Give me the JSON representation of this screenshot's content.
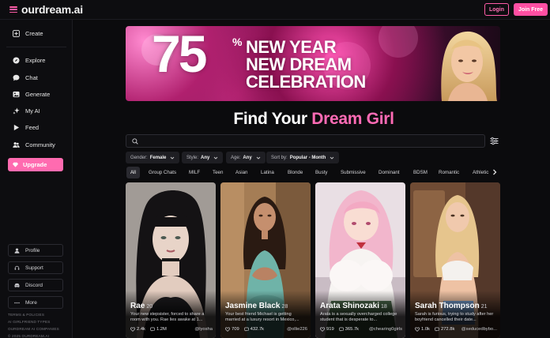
{
  "header": {
    "logo": "ourdream.ai",
    "login_label": "Login",
    "join_label": "Join Free"
  },
  "sidebar": {
    "items": [
      {
        "label": "Create",
        "icon": "plus-square-icon"
      },
      {
        "label": "Explore",
        "icon": "compass-icon"
      },
      {
        "label": "Chat",
        "icon": "chat-bubble-icon"
      },
      {
        "label": "Generate",
        "icon": "image-icon"
      },
      {
        "label": "My AI",
        "icon": "sparkle-icon"
      },
      {
        "label": "Feed",
        "icon": "play-icon"
      },
      {
        "label": "Community",
        "icon": "users-icon"
      }
    ],
    "upgrade_label": "Upgrade",
    "bottom": [
      {
        "label": "Profile",
        "icon": "user-icon"
      },
      {
        "label": "Support",
        "icon": "headset-icon"
      },
      {
        "label": "Discord",
        "icon": "discord-icon"
      },
      {
        "label": "More",
        "icon": "more-dots-icon"
      }
    ],
    "footer_links": [
      "TERMS & POLICIES",
      "AI GIRLFRIEND TYPES",
      "OURDREAM AI COMPANIES",
      "© 2025 OURDREAM.AI"
    ]
  },
  "banner": {
    "big": "75",
    "pct": "%",
    "line1": "NEW YEAR",
    "line2": "NEW DREAM",
    "line3": "CELEBRATION"
  },
  "headline": {
    "part1": "Find Your ",
    "part2": "Dream Girl"
  },
  "search": {
    "placeholder": "",
    "value": ""
  },
  "filters": [
    {
      "key": "Gender:",
      "value": "Female"
    },
    {
      "key": "Style:",
      "value": "Any"
    },
    {
      "key": "Age:",
      "value": "Any"
    },
    {
      "key": "Sort by:",
      "value": "Popular - Month"
    }
  ],
  "tags": [
    "All",
    "Group Chats",
    "MILF",
    "Teen",
    "Asian",
    "Latina",
    "Blonde",
    "Busty",
    "Submissive",
    "Dominant",
    "BDSM",
    "Romantic",
    "Athletic"
  ],
  "cards": [
    {
      "name": "Rae",
      "age": "20",
      "desc": "Your new stepsister, forced to share a room with you. Rae lies awake at 1...",
      "likes": "2.4k",
      "chats": "1.2M",
      "handle": "@lyosha"
    },
    {
      "name": "Jasmine Black",
      "age": "28",
      "desc": "Your best friend Michael is getting married at a luxury resort in Mexico,...",
      "likes": "709",
      "chats": "432.7k",
      "handle": "@ollie226"
    },
    {
      "name": "Arata Shinozaki",
      "age": "18",
      "desc": "Arata is a sexually overcharged college student that is desperate to...",
      "likes": "919",
      "chats": "365.7k",
      "handle": "@chearing0girls"
    },
    {
      "name": "Sarah Thompson",
      "age": "21",
      "desc": "Sarah is furious, trying to study after her boyfriend cancelled their date...",
      "likes": "1.0k",
      "chats": "272.8k",
      "handle": "@seducedbybo..."
    }
  ],
  "colors": {
    "accent": "#ff5ca8",
    "background": "#0b0b0d"
  }
}
